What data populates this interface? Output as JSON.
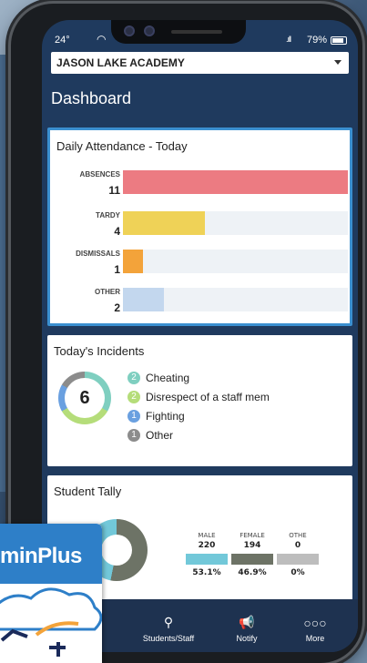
{
  "status": {
    "time": "24°",
    "signal": ".ıll",
    "battery": "79%"
  },
  "school_select": {
    "value": "JASON LAKE ACADEMY"
  },
  "page_title": "Dashboard",
  "attendance": {
    "title": "Daily Attendance - Today",
    "max": 11,
    "rows": [
      {
        "label": "ABSENCES",
        "count": "11",
        "value": 11,
        "color": "#ec7b82"
      },
      {
        "label": "TARDY",
        "count": "4",
        "value": 4,
        "color": "#efd257"
      },
      {
        "label": "DISMISSALS",
        "count": "1",
        "value": 1,
        "color": "#f3a33a"
      },
      {
        "label": "OTHER",
        "count": "2",
        "value": 2,
        "color": "#c3d7ee"
      }
    ]
  },
  "incidents": {
    "title": "Today's Incidents",
    "total": "6",
    "items": [
      {
        "count": "2",
        "label": "Cheating",
        "color": "#7fcfc0"
      },
      {
        "count": "2",
        "label": "Disrespect of a staff mem",
        "color": "#b5dd7a"
      },
      {
        "count": "1",
        "label": "Fighting",
        "color": "#6aa0e0"
      },
      {
        "count": "1",
        "label": "Other",
        "color": "#8c8c8c"
      }
    ]
  },
  "tally": {
    "title": "Student Tally",
    "columns": [
      {
        "label": "MALE",
        "count": "220",
        "pct": "53.1%",
        "color": "#72c8d9"
      },
      {
        "label": "FEMALE",
        "count": "194",
        "pct": "46.9%",
        "color": "#6d7366"
      },
      {
        "label": "OTHE",
        "count": "0",
        "pct": "0%",
        "color": "#bdbdbd"
      }
    ]
  },
  "nav": {
    "students": "Students/Staff",
    "notify": "Notify",
    "more": "More"
  },
  "logo": {
    "text": "minPlus"
  }
}
